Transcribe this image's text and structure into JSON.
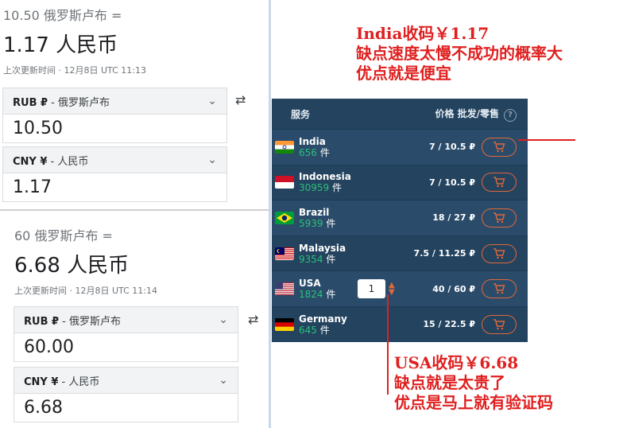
{
  "conversion_1": {
    "from_text": "10.50 俄罗斯卢布 =",
    "to_text": "1.17 人民币",
    "updated": "上次更新时间 · 12月8日 UTC 11:13",
    "from_currency": "俄罗斯卢布",
    "from_value": "10.50",
    "to_currency": "人民币",
    "to_value": "1.17"
  },
  "conversion_2": {
    "from_text": "60 俄罗斯卢布 =",
    "to_text": "6.68 人民币",
    "updated": "上次更新时间 · 12月8日 UTC 11:14",
    "from_currency": "俄罗斯卢布",
    "from_value": "60.00",
    "to_currency": "人民币",
    "to_value": "6.68"
  },
  "currency_codes": {
    "rub": "RUB ₽",
    "cny": "CNY ¥"
  },
  "swap_glyph": "⇄",
  "panel": {
    "header_service": "服务",
    "header_price": "价格 批发/零售",
    "help_glyph": "?",
    "count_suffix": "件",
    "rows": [
      {
        "country": "India",
        "count": "656",
        "price": "7 / 10.5 ₽",
        "flag": "india"
      },
      {
        "country": "Indonesia",
        "count": "30959",
        "price": "7 / 10.5 ₽",
        "flag": "indonesia"
      },
      {
        "country": "Brazil",
        "count": "5939",
        "price": "18 / 27 ₽",
        "flag": "brazil"
      },
      {
        "country": "Malaysia",
        "count": "9354",
        "price": "7.5 / 11.25 ₽",
        "flag": "malaysia"
      },
      {
        "country": "USA",
        "count": "1824",
        "price": "40 / 60 ₽",
        "flag": "usa",
        "qty": "1"
      },
      {
        "country": "Germany",
        "count": "645",
        "price": "15 / 22.5 ₽",
        "flag": "germany"
      }
    ]
  },
  "annotations": {
    "india": [
      "India收码￥1.17",
      "缺点速度太慢不成功的概率大",
      "优点就是便宜"
    ],
    "usa": [
      "USA收码￥6.68",
      "缺点就是太贵了",
      "优点是马上就有验证码"
    ]
  },
  "colors": {
    "panel_bg": "#23435f",
    "accent": "#e0683a",
    "count_green": "#2ac07a",
    "annotation_red": "#e02020"
  }
}
